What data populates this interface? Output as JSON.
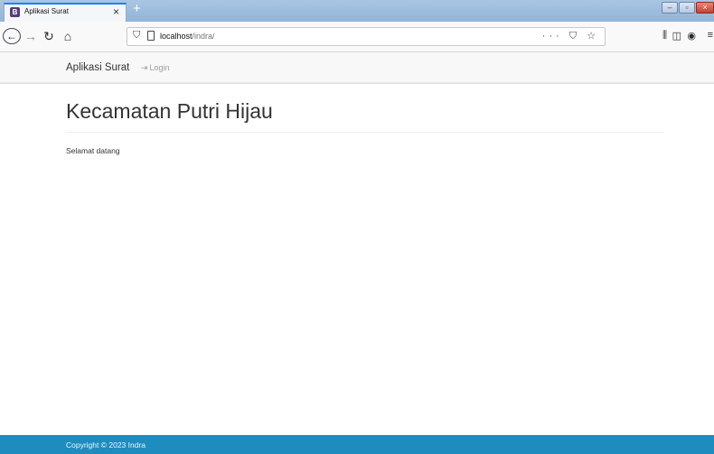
{
  "browser": {
    "tab_title": "Aplikasi Surat",
    "tab_favicon": "B",
    "tab_close": "×",
    "new_tab": "+",
    "url_host": "localhost",
    "url_path": "/indra/",
    "url_actions": "··· ⛉ ☆",
    "icons": [
      "back-icon",
      "forward-icon",
      "reload-icon",
      "home-icon",
      "shield-icon",
      "page-icon",
      "library-icon",
      "sidebar-icon",
      "account-icon",
      "menu-icon"
    ]
  },
  "navbar": {
    "brand": "Aplikasi Surat",
    "login": "Login"
  },
  "main": {
    "title": "Kecamatan Putri Hijau",
    "welcome": "Selamat datang"
  },
  "footer": {
    "text": "Copyright © 2023 Indra"
  },
  "colors": {
    "footer_bg": "#1f8cc0",
    "navbar_bg": "#f8f8f8",
    "tab_accent": "#0a84ff"
  }
}
